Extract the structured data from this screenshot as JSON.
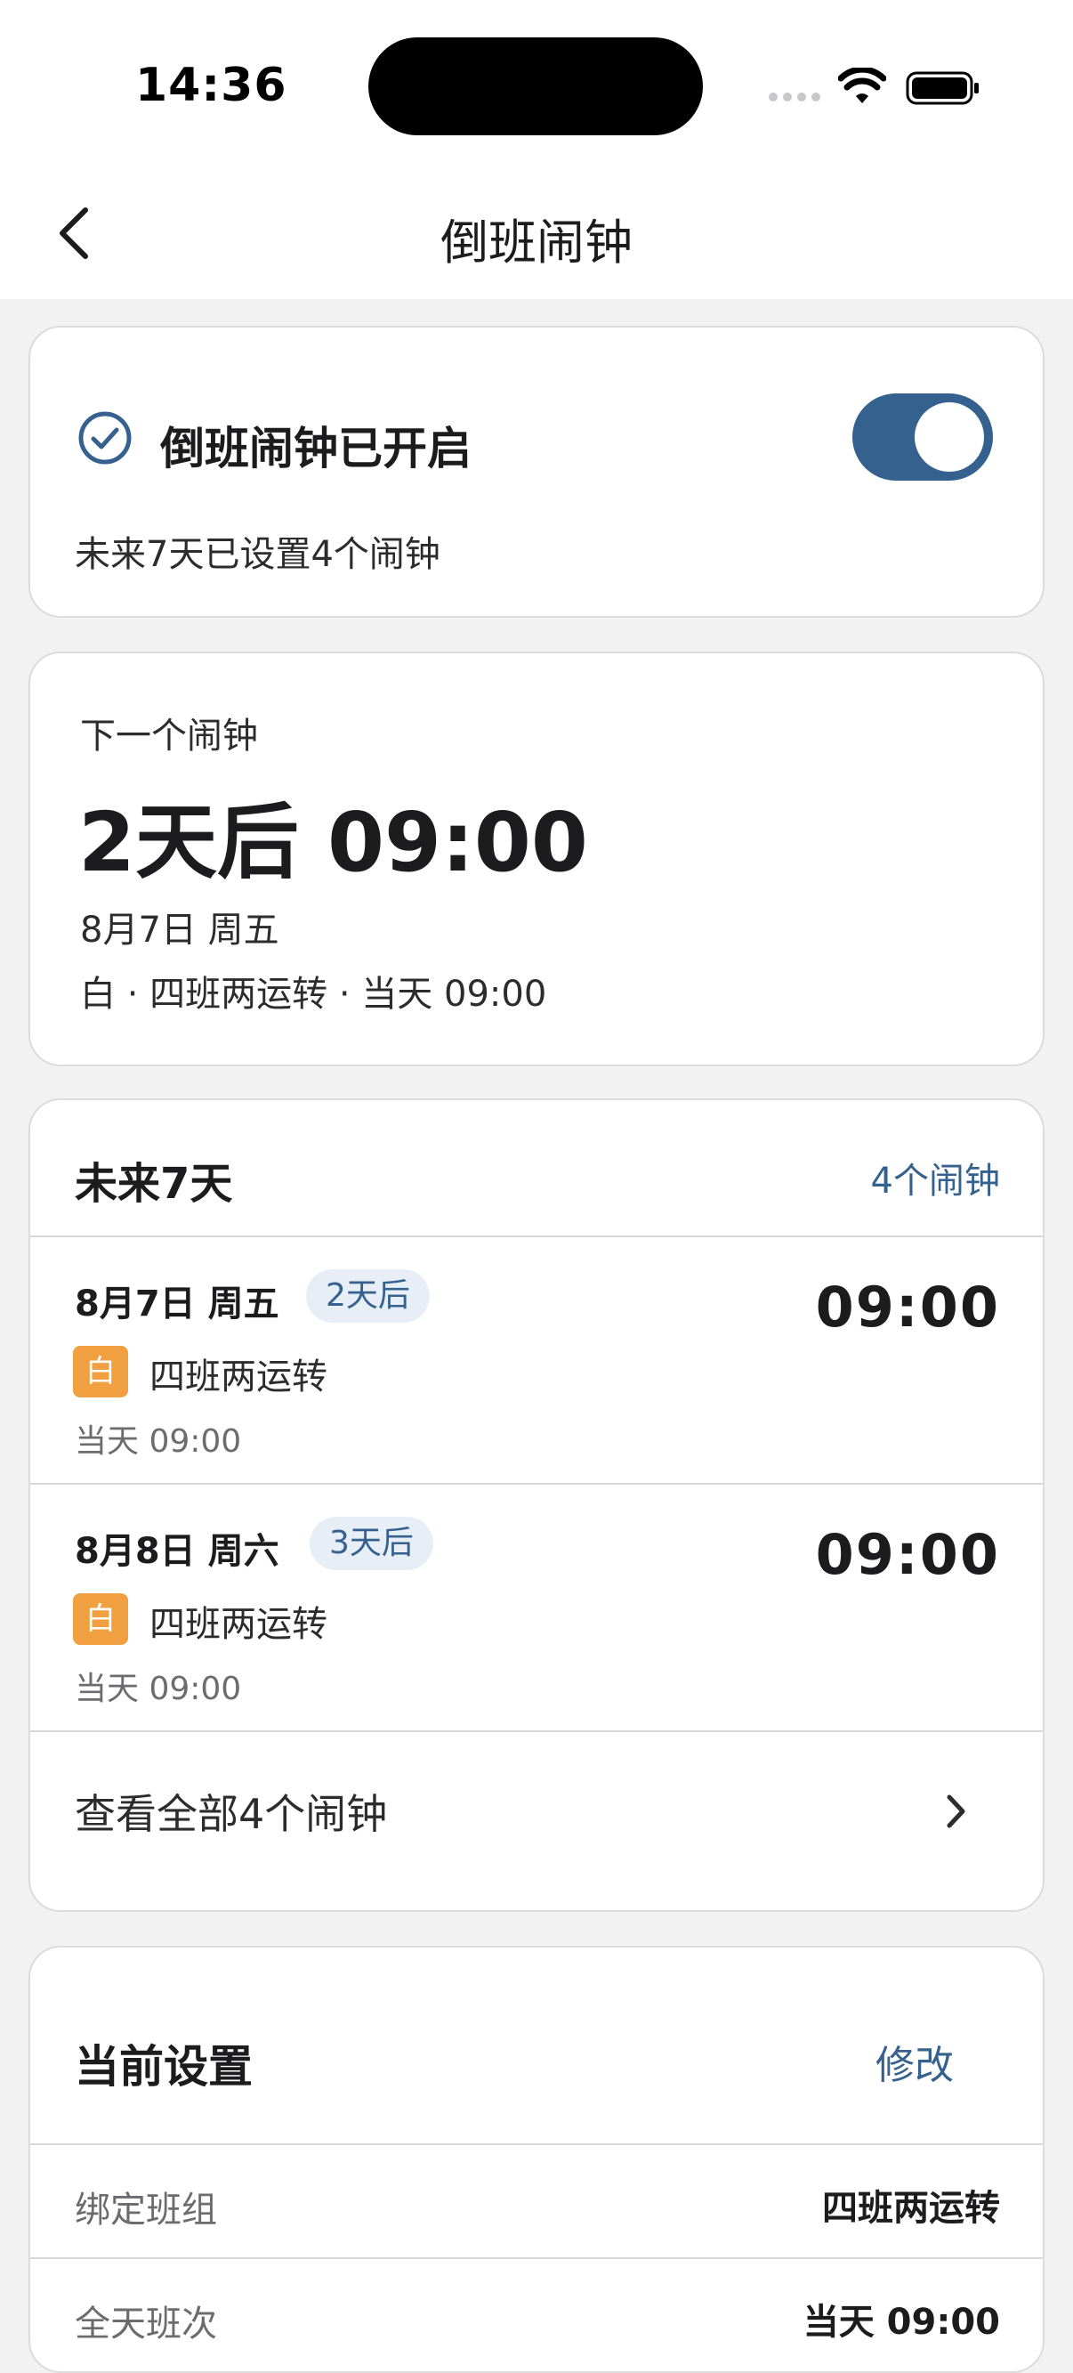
{
  "status_bar": {
    "time": "14:36"
  },
  "nav": {
    "title": "倒班闹钟"
  },
  "status_card": {
    "title": "倒班闹钟已开启",
    "toggle_on": true,
    "subtitle": "未来7天已设置4个闹钟"
  },
  "next_alarm": {
    "label": "下一个闹钟",
    "headline": "2天后 09:00",
    "date": "8月7日 周五",
    "detail": "白 · 四班两运转 · 当天 09:00"
  },
  "upcoming": {
    "title": "未来7天",
    "count": "4个闹钟",
    "items": [
      {
        "date": "8月7日 周五",
        "badge": "2天后",
        "time": "09:00",
        "shift": "白",
        "group": "四班两运转",
        "sub": "当天 09:00"
      },
      {
        "date": "8月8日 周六",
        "badge": "3天后",
        "time": "09:00",
        "shift": "白",
        "group": "四班两运转",
        "sub": "当天 09:00"
      }
    ],
    "view_all": "查看全部4个闹钟"
  },
  "settings": {
    "title": "当前设置",
    "edit": "修改",
    "rows": [
      {
        "key": "绑定班组",
        "value": "四班两运转"
      },
      {
        "key": "全天班次",
        "value": "当天 09:00"
      }
    ]
  },
  "colors": {
    "accent": "#35618f",
    "shift_day": "#f0a040",
    "background": "#f2f2f2"
  }
}
